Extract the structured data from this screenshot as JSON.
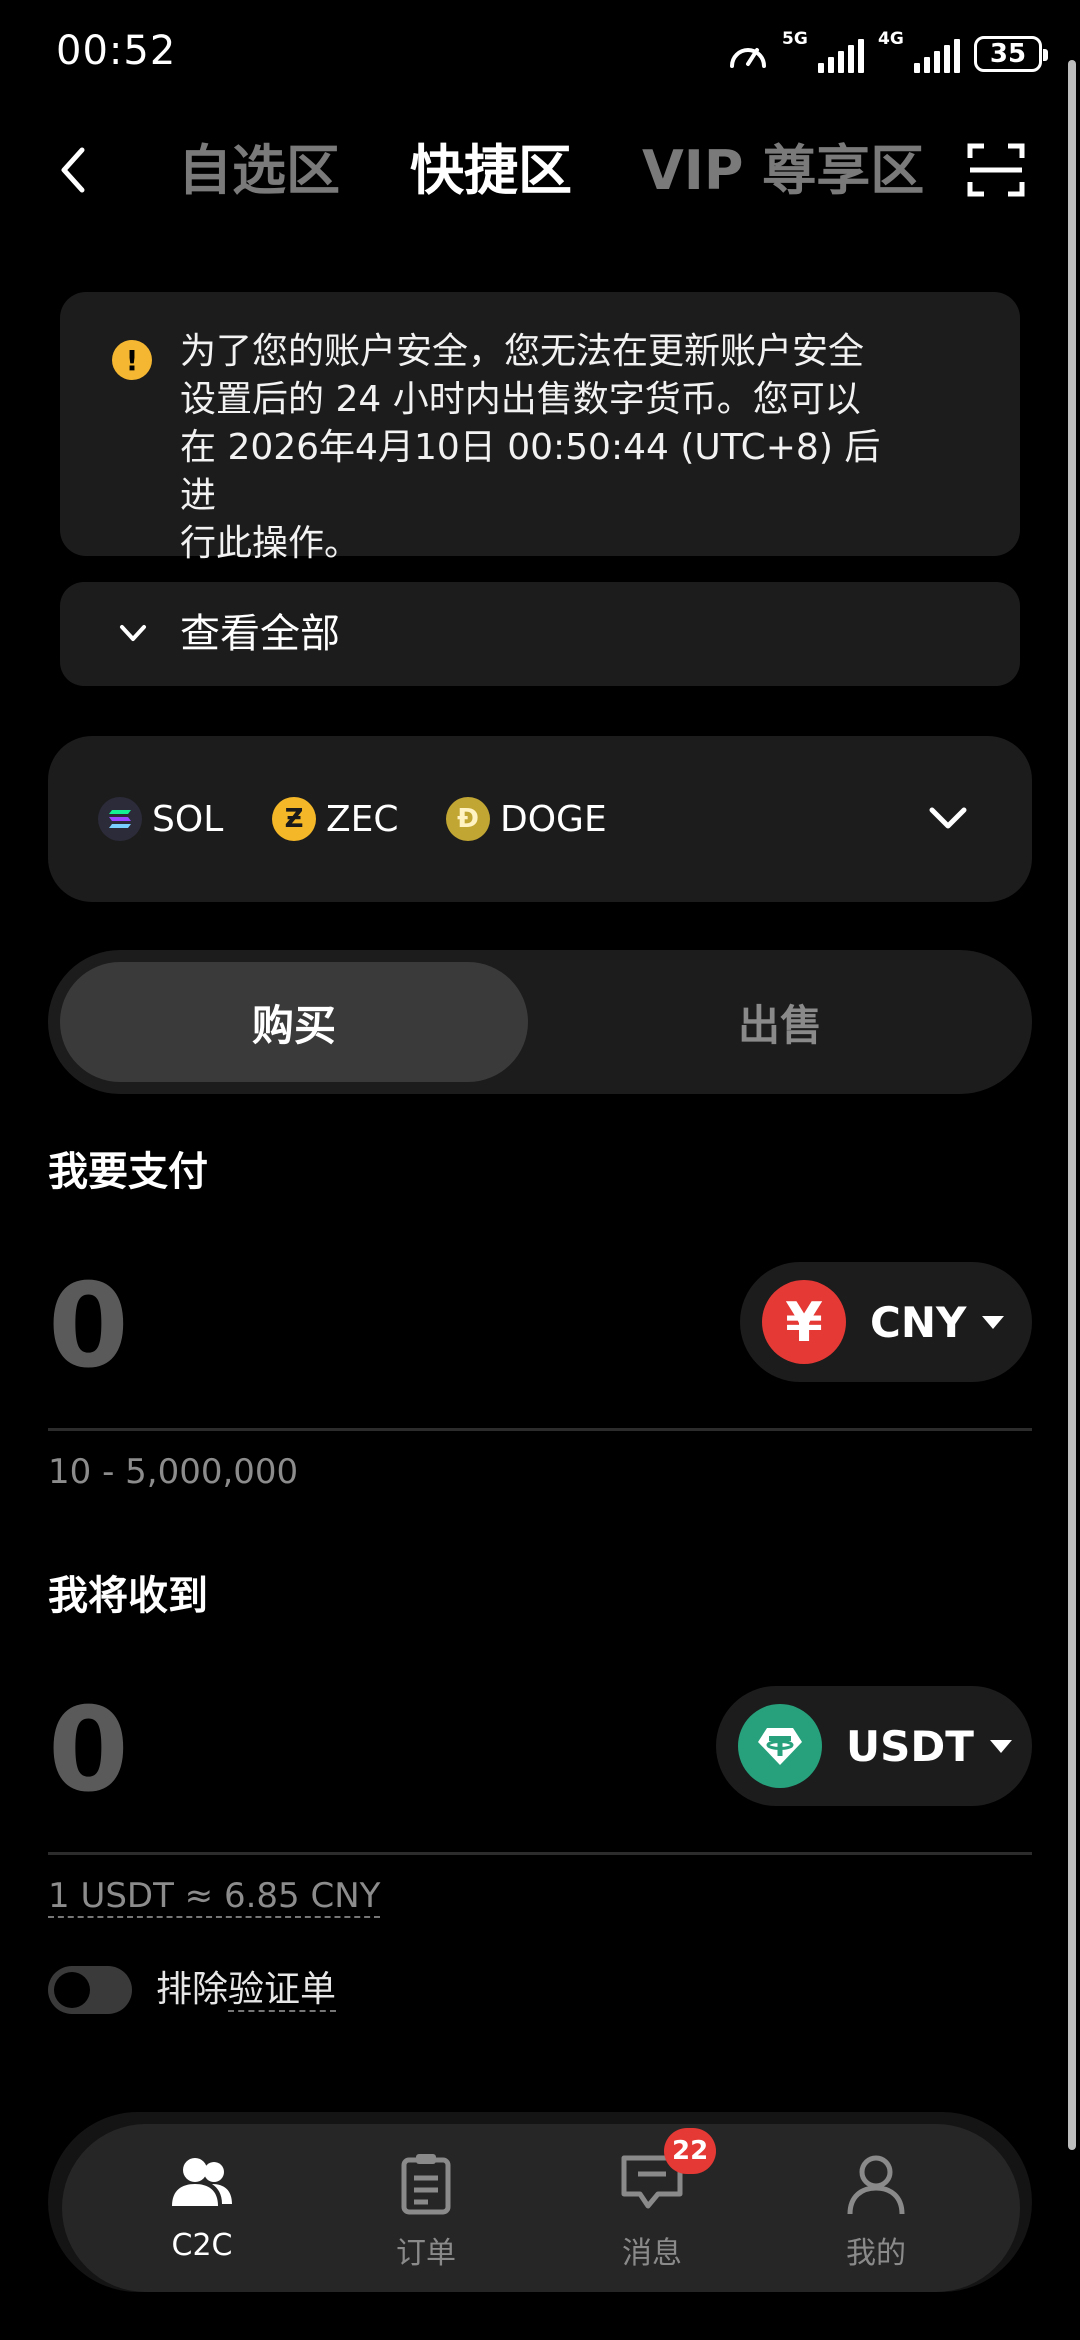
{
  "status_bar": {
    "time": "00:52",
    "net1": "5G",
    "net2": "4G",
    "battery": "35"
  },
  "header": {
    "tabs": [
      {
        "label": "自选区",
        "active": false
      },
      {
        "label": "快捷区",
        "active": true
      },
      {
        "label": "VIP 尊享区",
        "active": false
      }
    ]
  },
  "notice": {
    "lines": [
      "为了您的账户安全，您无法在更新账户安全",
      "设置后的 24 小时内出售数字货币。您可以",
      "在 2026年4月10日 00:50:44 (UTC+8) 后进",
      "行此操作。"
    ],
    "view_all": "查看全部"
  },
  "coins": [
    {
      "symbol": "SOL",
      "color": "#2b2b3a"
    },
    {
      "symbol": "ZEC",
      "color": "#f4b728"
    },
    {
      "symbol": "DOGE",
      "color": "#c2a633"
    }
  ],
  "trade": {
    "buy_label": "购买",
    "sell_label": "出售",
    "pay_label": "我要支付",
    "pay_amount": "0",
    "pay_currency": "CNY",
    "pay_currency_symbol": "¥",
    "pay_range": "10 - 5,000,000",
    "receive_label": "我将收到",
    "receive_amount": "0",
    "receive_currency": "USDT",
    "rate": "1 USDT ≈ 6.85 CNY",
    "toggle_label_a": "排除",
    "toggle_label_b": "验证单"
  },
  "nav": {
    "items": [
      {
        "label": "C2C",
        "active": true
      },
      {
        "label": "订单",
        "active": false
      },
      {
        "label": "消息",
        "active": false
      },
      {
        "label": "我的",
        "active": false
      }
    ],
    "message_badge": "22"
  },
  "colors": {
    "cny": "#e53935",
    "usdt": "#26a17b",
    "warning": "#f5b731",
    "badge": "#e53935"
  }
}
